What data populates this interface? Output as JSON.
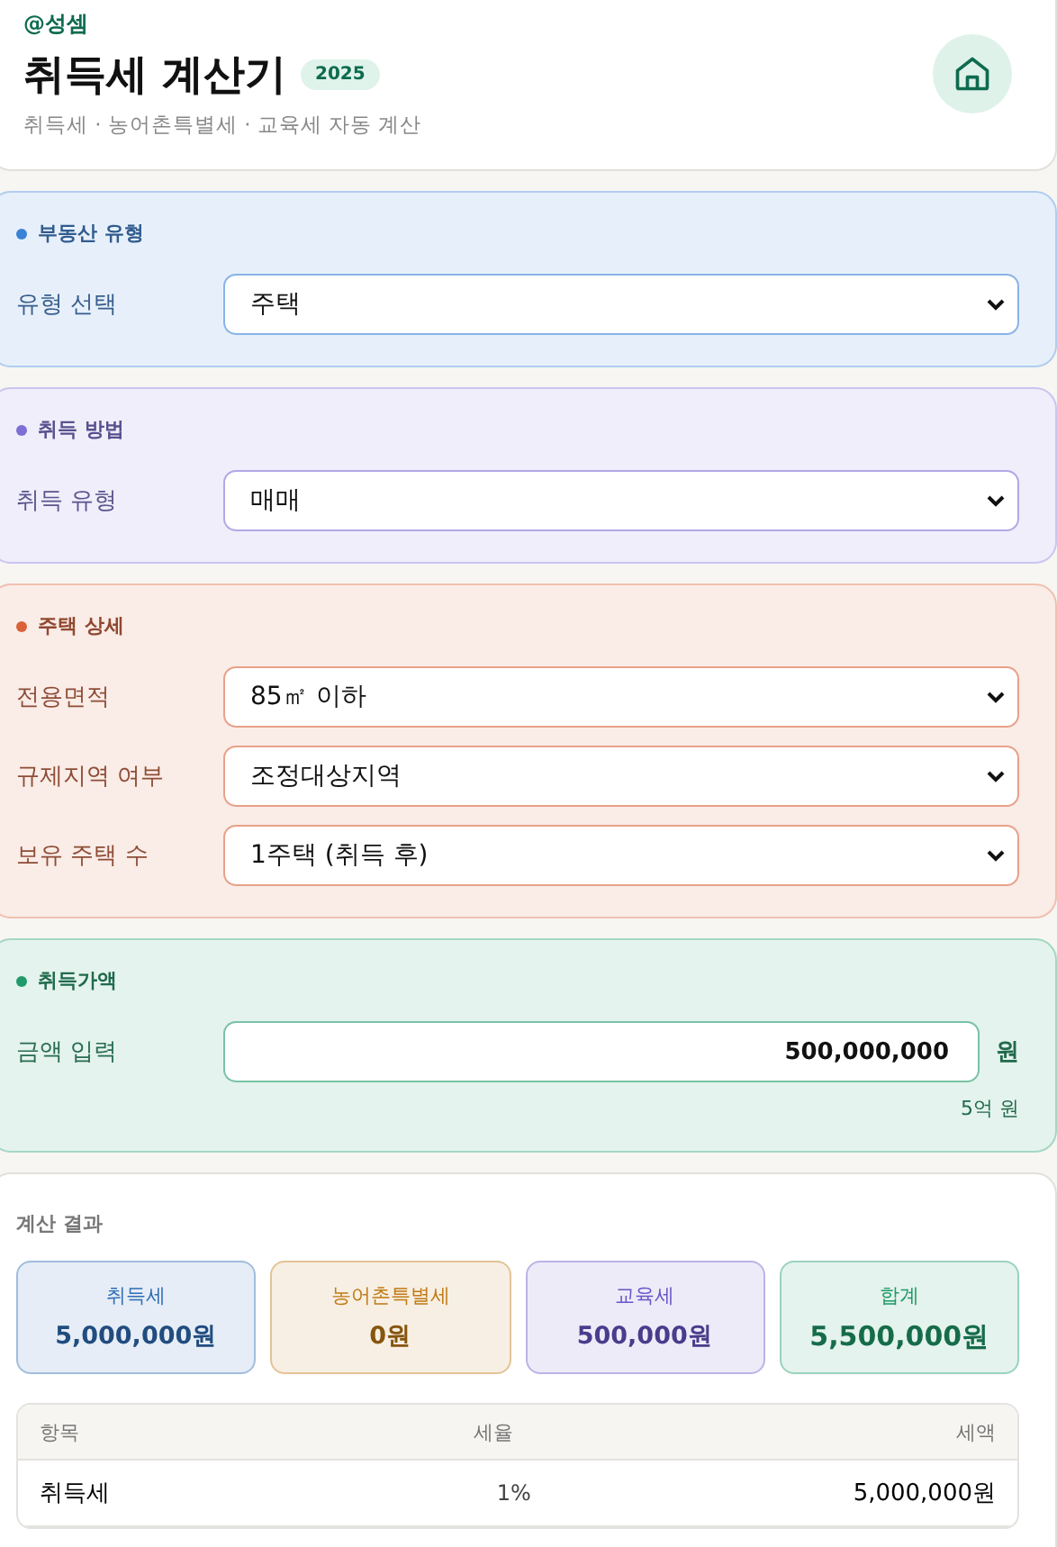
{
  "header": {
    "author": "@성셈",
    "title": "취득세 계산기",
    "badge": "2025",
    "subtitle": "취득세 · 농어촌특별세 · 교육세 자동 계산"
  },
  "sections": [
    {
      "title": "부동산 유형",
      "color": "#3b82d6",
      "fields": [
        {
          "kind": "select",
          "label": "유형 선택",
          "value": "주택"
        }
      ]
    },
    {
      "title": "취득 방법",
      "color": "#7c6fd6",
      "fields": [
        {
          "kind": "select",
          "label": "취득 유형",
          "value": "매매"
        }
      ]
    },
    {
      "title": "주택 상세",
      "color": "#d9623a",
      "fields": [
        {
          "kind": "select",
          "label": "전용면적",
          "value": "85㎡ 이하"
        },
        {
          "kind": "select",
          "label": "규제지역 여부",
          "value": "조정대상지역"
        },
        {
          "kind": "select",
          "label": "보유 주택 수",
          "value": "1주택 (취득 후)"
        }
      ]
    },
    {
      "title": "취득가액",
      "color": "#1f9a6a",
      "fields": [
        {
          "kind": "input",
          "label": "금액 입력",
          "value": "500,000,000",
          "unit": "원",
          "hint": "5억 원"
        }
      ]
    }
  ],
  "results": {
    "title": "계산 결과",
    "summary": [
      {
        "label": "취득세",
        "value": "5,000,000원",
        "color": "#2f6db5"
      },
      {
        "label": "농어촌특별세",
        "value": "0원",
        "color": "#c07a14"
      },
      {
        "label": "교육세",
        "value": "500,000원",
        "color": "#6a55c8"
      },
      {
        "label": "합계",
        "value": "5,500,000원",
        "color": "#1f9a6a"
      }
    ],
    "table": {
      "columns": [
        "항목",
        "세율",
        "세액"
      ],
      "rows": [
        [
          "취득세",
          "1%",
          "5,000,000원"
        ]
      ]
    }
  }
}
